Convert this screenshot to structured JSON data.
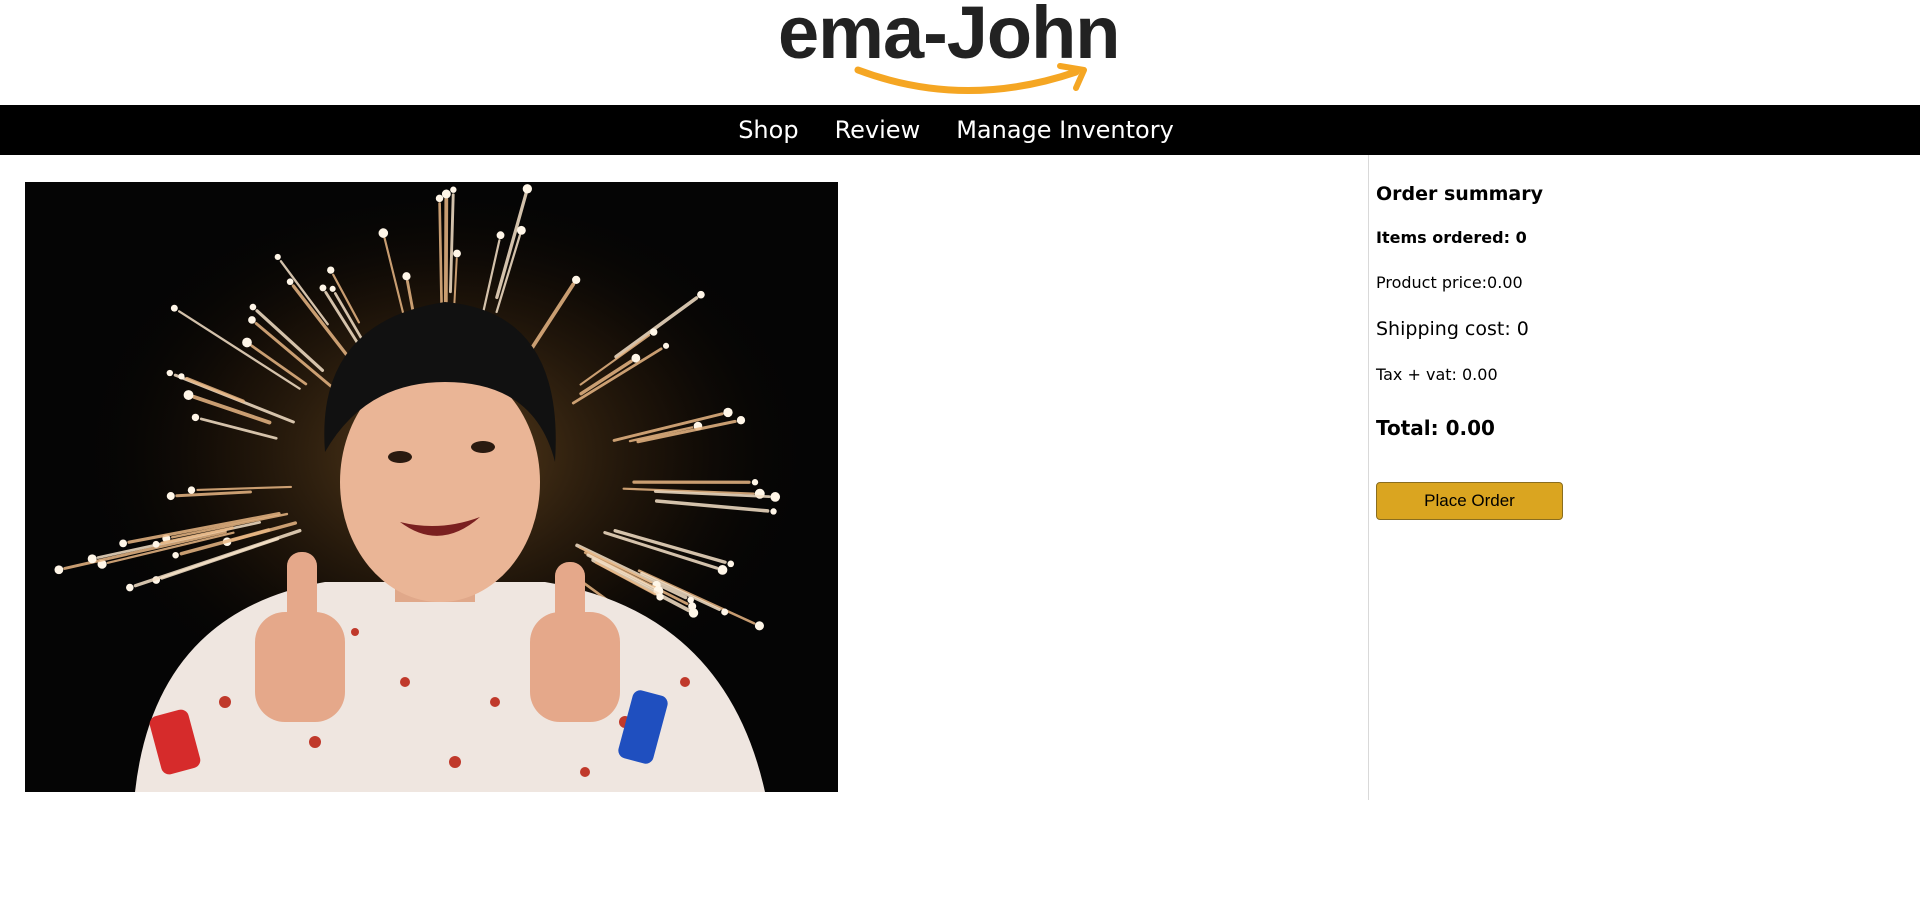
{
  "logo": {
    "text": "ema-John",
    "accent_color": "#f5a623"
  },
  "nav": {
    "items": [
      {
        "label": "Shop"
      },
      {
        "label": "Review"
      },
      {
        "label": "Manage Inventory"
      }
    ]
  },
  "main": {
    "image": {
      "description_icon": "celebration-image"
    }
  },
  "order_summary": {
    "title": "Order summary",
    "items_ordered": "Items ordered: 0",
    "product_price": "Product price:0.00",
    "shipping_cost": "Shipping cost: 0",
    "tax_vat": "Tax + vat: 0.00",
    "total": "Total: 0.00",
    "place_order_label": "Place Order",
    "button_color": "#daa520"
  }
}
